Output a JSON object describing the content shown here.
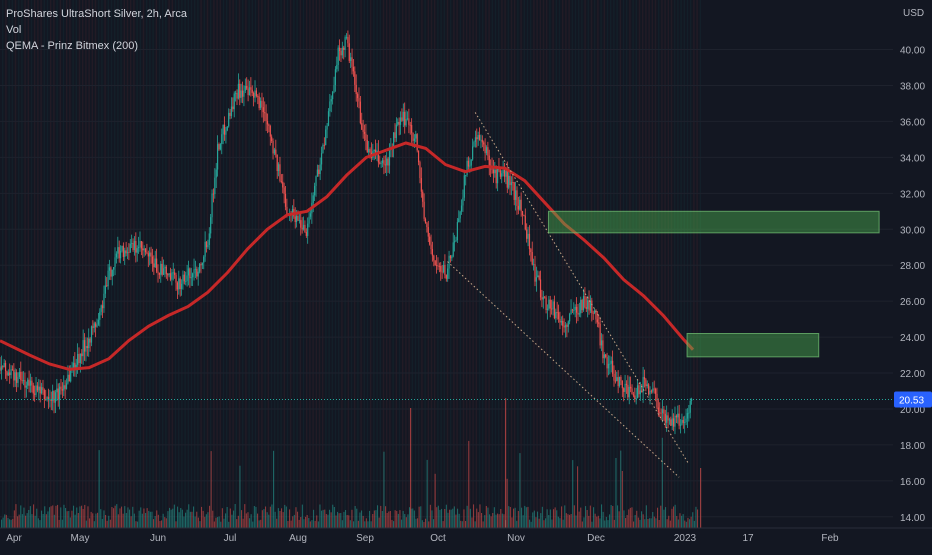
{
  "chart_data": {
    "type": "candlestick",
    "title": "ProShares UltraShort Silver, 2h, Arca",
    "indicators": [
      "Vol",
      "QEMA - Prinz Bitmex (200)"
    ],
    "currency_label": "USD",
    "y_ticks": [
      "14.00",
      "16.00",
      "18.00",
      "20.00",
      "22.00",
      "24.00",
      "26.00",
      "28.00",
      "30.00",
      "32.00",
      "34.00",
      "36.00",
      "38.00",
      "40.00"
    ],
    "x_ticks": [
      "Apr",
      "May",
      "Jun",
      "Jul",
      "Aug",
      "Sep",
      "Oct",
      "Nov",
      "Dec",
      "2023",
      "17",
      "Feb"
    ],
    "ylim": [
      13.6,
      42.2
    ],
    "last_price": "20.53",
    "colors": {
      "up": "#26a69a",
      "down": "#ef5350",
      "ema": "#c62828",
      "zone": "#4caf50",
      "last": "#2962ff",
      "bg": "#131722"
    },
    "price_path": [
      [
        0,
        22.3
      ],
      [
        3,
        21.3
      ],
      [
        5,
        20.5
      ],
      [
        6,
        20.9
      ],
      [
        8,
        23.0
      ],
      [
        10,
        25.0
      ],
      [
        11,
        27.5
      ],
      [
        12,
        28.8
      ],
      [
        14,
        29.0
      ],
      [
        16,
        27.8
      ],
      [
        18,
        27.0
      ],
      [
        20,
        27.8
      ],
      [
        21,
        29.5
      ],
      [
        22,
        34.5
      ],
      [
        24,
        37.8
      ],
      [
        26,
        37.3
      ],
      [
        27,
        36.2
      ],
      [
        28,
        33.5
      ],
      [
        29,
        31.2
      ],
      [
        31,
        30.0
      ],
      [
        32,
        33.0
      ],
      [
        33,
        35.5
      ],
      [
        34,
        39.5
      ],
      [
        35,
        40.5
      ],
      [
        36,
        37.5
      ],
      [
        37,
        34.5
      ],
      [
        38,
        34.0
      ],
      [
        39,
        33.5
      ],
      [
        40,
        35.5
      ],
      [
        41,
        36.3
      ],
      [
        42,
        35.0
      ],
      [
        43,
        30.0
      ],
      [
        44,
        28.0
      ],
      [
        45,
        27.5
      ],
      [
        46,
        29.5
      ],
      [
        47,
        33.0
      ],
      [
        48,
        35.0
      ],
      [
        49,
        34.5
      ],
      [
        50,
        33.0
      ],
      [
        51,
        33.0
      ],
      [
        52,
        32.0
      ],
      [
        53,
        30.5
      ],
      [
        54,
        27.5
      ],
      [
        55,
        26.0
      ],
      [
        56,
        25.5
      ],
      [
        57,
        24.5
      ],
      [
        58,
        25.5
      ],
      [
        59,
        26.0
      ],
      [
        60,
        25.5
      ],
      [
        61,
        23.0
      ],
      [
        62,
        22.0
      ],
      [
        64,
        20.5
      ],
      [
        65,
        21.5
      ],
      [
        66,
        21.0
      ],
      [
        67,
        19.5
      ],
      [
        69,
        19.3
      ],
      [
        70,
        20.5
      ]
    ],
    "ema_path": [
      [
        0,
        23.8
      ],
      [
        3,
        23.0
      ],
      [
        5,
        22.5
      ],
      [
        7,
        22.2
      ],
      [
        9,
        22.3
      ],
      [
        11,
        22.8
      ],
      [
        13,
        23.8
      ],
      [
        15,
        24.6
      ],
      [
        17,
        25.2
      ],
      [
        19,
        25.7
      ],
      [
        21,
        26.5
      ],
      [
        23,
        27.6
      ],
      [
        25,
        28.9
      ],
      [
        27,
        30.0
      ],
      [
        29,
        30.8
      ],
      [
        31,
        31.0
      ],
      [
        33,
        31.8
      ],
      [
        35,
        33.0
      ],
      [
        37,
        34.0
      ],
      [
        39,
        34.4
      ],
      [
        41,
        34.8
      ],
      [
        43,
        34.5
      ],
      [
        45,
        33.6
      ],
      [
        47,
        33.2
      ],
      [
        49,
        33.5
      ],
      [
        51,
        33.4
      ],
      [
        53,
        32.7
      ],
      [
        55,
        31.5
      ],
      [
        57,
        30.3
      ],
      [
        59,
        29.4
      ],
      [
        61,
        28.4
      ],
      [
        63,
        27.2
      ],
      [
        65,
        26.3
      ],
      [
        67,
        25.2
      ],
      [
        69,
        23.9
      ],
      [
        70,
        23.3
      ]
    ],
    "zones": [
      {
        "from": 55.4,
        "to": 88.8,
        "low": 29.8,
        "high": 31.0
      },
      {
        "from": 69.4,
        "to": 82.7,
        "low": 22.9,
        "high": 24.2
      }
    ],
    "trendlines": [
      {
        "from": [
          48,
          36.5
        ],
        "to": [
          69.5,
          17.0
        ]
      },
      {
        "from": [
          45.2,
          28.2
        ],
        "to": [
          68.6,
          16.2
        ]
      }
    ]
  }
}
